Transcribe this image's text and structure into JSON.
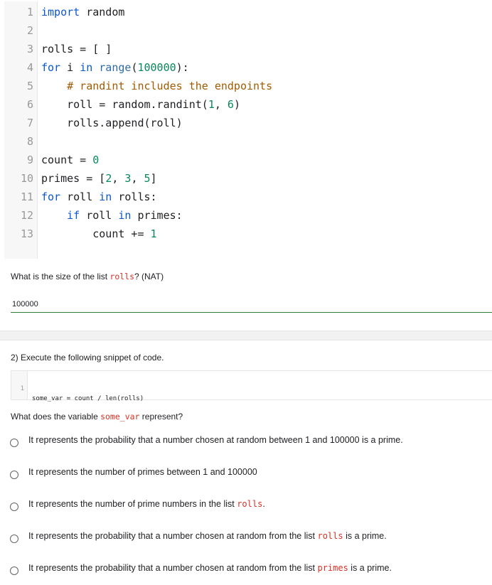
{
  "code_block_1": {
    "lines": [
      {
        "num": "1",
        "parts": [
          {
            "t": "import",
            "c": "kw"
          },
          {
            "t": " random",
            "c": "op"
          }
        ]
      },
      {
        "num": "2",
        "parts": []
      },
      {
        "num": "3",
        "parts": [
          {
            "t": "rolls = [ ]",
            "c": "op"
          }
        ]
      },
      {
        "num": "4",
        "parts": [
          {
            "t": "for",
            "c": "kw"
          },
          {
            "t": " i ",
            "c": "op"
          },
          {
            "t": "in",
            "c": "kw"
          },
          {
            "t": " ",
            "c": "op"
          },
          {
            "t": "range",
            "c": "fn"
          },
          {
            "t": "(",
            "c": "op"
          },
          {
            "t": "100000",
            "c": "num"
          },
          {
            "t": "):",
            "c": "op"
          }
        ]
      },
      {
        "num": "5",
        "parts": [
          {
            "t": "    ",
            "c": "op"
          },
          {
            "t": "# randint includes the endpoints",
            "c": "cmt"
          }
        ]
      },
      {
        "num": "6",
        "parts": [
          {
            "t": "    roll = random.randint(",
            "c": "op"
          },
          {
            "t": "1",
            "c": "num"
          },
          {
            "t": ", ",
            "c": "op"
          },
          {
            "t": "6",
            "c": "num"
          },
          {
            "t": ")",
            "c": "op"
          }
        ]
      },
      {
        "num": "7",
        "parts": [
          {
            "t": "    rolls.append(roll)",
            "c": "op"
          }
        ]
      },
      {
        "num": "8",
        "parts": []
      },
      {
        "num": "9",
        "parts": [
          {
            "t": "count = ",
            "c": "op"
          },
          {
            "t": "0",
            "c": "num"
          }
        ]
      },
      {
        "num": "10",
        "parts": [
          {
            "t": "primes = [",
            "c": "op"
          },
          {
            "t": "2",
            "c": "num"
          },
          {
            "t": ", ",
            "c": "op"
          },
          {
            "t": "3",
            "c": "num"
          },
          {
            "t": ", ",
            "c": "op"
          },
          {
            "t": "5",
            "c": "num"
          },
          {
            "t": "]",
            "c": "op"
          }
        ]
      },
      {
        "num": "11",
        "parts": [
          {
            "t": "for",
            "c": "kw"
          },
          {
            "t": " roll ",
            "c": "op"
          },
          {
            "t": "in",
            "c": "kw"
          },
          {
            "t": " rolls:",
            "c": "op"
          }
        ]
      },
      {
        "num": "12",
        "parts": [
          {
            "t": "    ",
            "c": "op"
          },
          {
            "t": "if",
            "c": "kw"
          },
          {
            "t": " roll ",
            "c": "op"
          },
          {
            "t": "in",
            "c": "kw"
          },
          {
            "t": " primes:",
            "c": "op"
          }
        ]
      },
      {
        "num": "13",
        "parts": [
          {
            "t": "        count += ",
            "c": "op"
          },
          {
            "t": "1",
            "c": "num"
          }
        ]
      }
    ]
  },
  "question_1": {
    "text_before": "What is the size of the list ",
    "code": "rolls",
    "text_after": "? (NAT)",
    "answer": "100000"
  },
  "question_2": {
    "heading": "2) Execute the following snippet of code.",
    "code_line_num": "1",
    "code_line": "some_var = count / len(rolls)",
    "question_before": "What does the variable ",
    "question_code": "some_var",
    "question_after": " represent?",
    "options": [
      {
        "before": "It represents the probability that a number chosen at random between 1 and 100000 is a prime.",
        "code": "",
        "after": ""
      },
      {
        "before": "It represents the number of primes between 1 and 100000",
        "code": "",
        "after": ""
      },
      {
        "before": "It represents the number of prime numbers in the list ",
        "code": "rolls",
        "after": "."
      },
      {
        "before": "It represents the probability that a number chosen at random from the list ",
        "code": "rolls",
        "after": " is a prime."
      },
      {
        "before": "It represents the probability that a number chosen at random from the list ",
        "code": "primes",
        "after": " is a prime."
      }
    ]
  }
}
